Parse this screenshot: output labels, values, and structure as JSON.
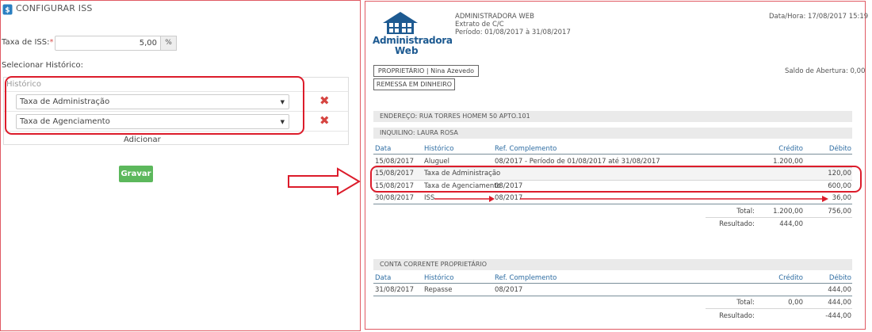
{
  "config": {
    "title": "CONFIGURAR ISS",
    "iss_label": "Taxa de ISS:",
    "iss_required": "*",
    "iss_value": "5,00",
    "iss_unit": "%",
    "hist_section_label": "Selecionar Histórico:",
    "hist_table_header": "Histórico",
    "selects": [
      "Taxa de Administração",
      "Taxa de Agenciamento"
    ],
    "add_label": "Adicionar",
    "save_label": "Gravar"
  },
  "report": {
    "logo_line1": "Administradora",
    "logo_line2": "Web",
    "company": "ADMINISTRADORA WEB",
    "subtitle": "Extrato de C/C",
    "period": "Período: 01/08/2017 à 31/08/2017",
    "datetime": "Data/Hora: 17/08/2017 15:19",
    "owner_box": "PROPRIETÁRIO | Nina Azevedo",
    "remessa_box": "REMESSA EM DINHEIRO",
    "opening_balance": "Saldo de Abertura: 0,00",
    "address": "ENDEREÇO: RUA TORRES HOMEM 50 APTO.101",
    "tenant": "INQUILINO: LAURA ROSA",
    "columns": [
      "Data",
      "Histórico",
      "Ref. Complemento",
      "Crédito",
      "Débito"
    ],
    "rows": [
      {
        "date": "15/08/2017",
        "hist": "Aluguel",
        "ref": "08/2017 - Período de 01/08/2017 até 31/08/2017",
        "credit": "1.200,00",
        "debit": ""
      },
      {
        "date": "15/08/2017",
        "hist": "Taxa de Administração",
        "ref": "",
        "credit": "",
        "debit": "120,00"
      },
      {
        "date": "15/08/2017",
        "hist": "Taxa de Agenciamento",
        "ref": "08/2017",
        "credit": "",
        "debit": "600,00"
      },
      {
        "date": "30/08/2017",
        "hist": "ISS",
        "ref": "08/2017",
        "credit": "",
        "debit": "36,00"
      }
    ],
    "total_label": "Total:",
    "total_credit": "1.200,00",
    "total_debit": "756,00",
    "result_label": "Resultado:",
    "result_value": "444,00",
    "cc_title": "CONTA CORRENTE PROPRIETÁRIO",
    "cc_columns": [
      "Data",
      "Histórico",
      "Ref. Complemento",
      "Crédito",
      "Débito"
    ],
    "cc_rows": [
      {
        "date": "31/08/2017",
        "hist": "Repasse",
        "ref": "08/2017",
        "credit": "",
        "debit": "444,00"
      }
    ],
    "cc_total_label": "Total:",
    "cc_total_credit": "0,00",
    "cc_total_debit": "444,00",
    "cc_result_label": "Resultado:",
    "cc_result_value": "-444,00"
  },
  "colors": {
    "accent_red": "#dc1c2b",
    "save_green": "#5cb85c",
    "header_blue": "#2d6ca2",
    "logo_blue": "#1d5a91"
  },
  "icons": [
    "settings-app-icon",
    "remove-x-icon",
    "chevron-down-icon",
    "house-logo-icon",
    "right-arrow-icon"
  ]
}
